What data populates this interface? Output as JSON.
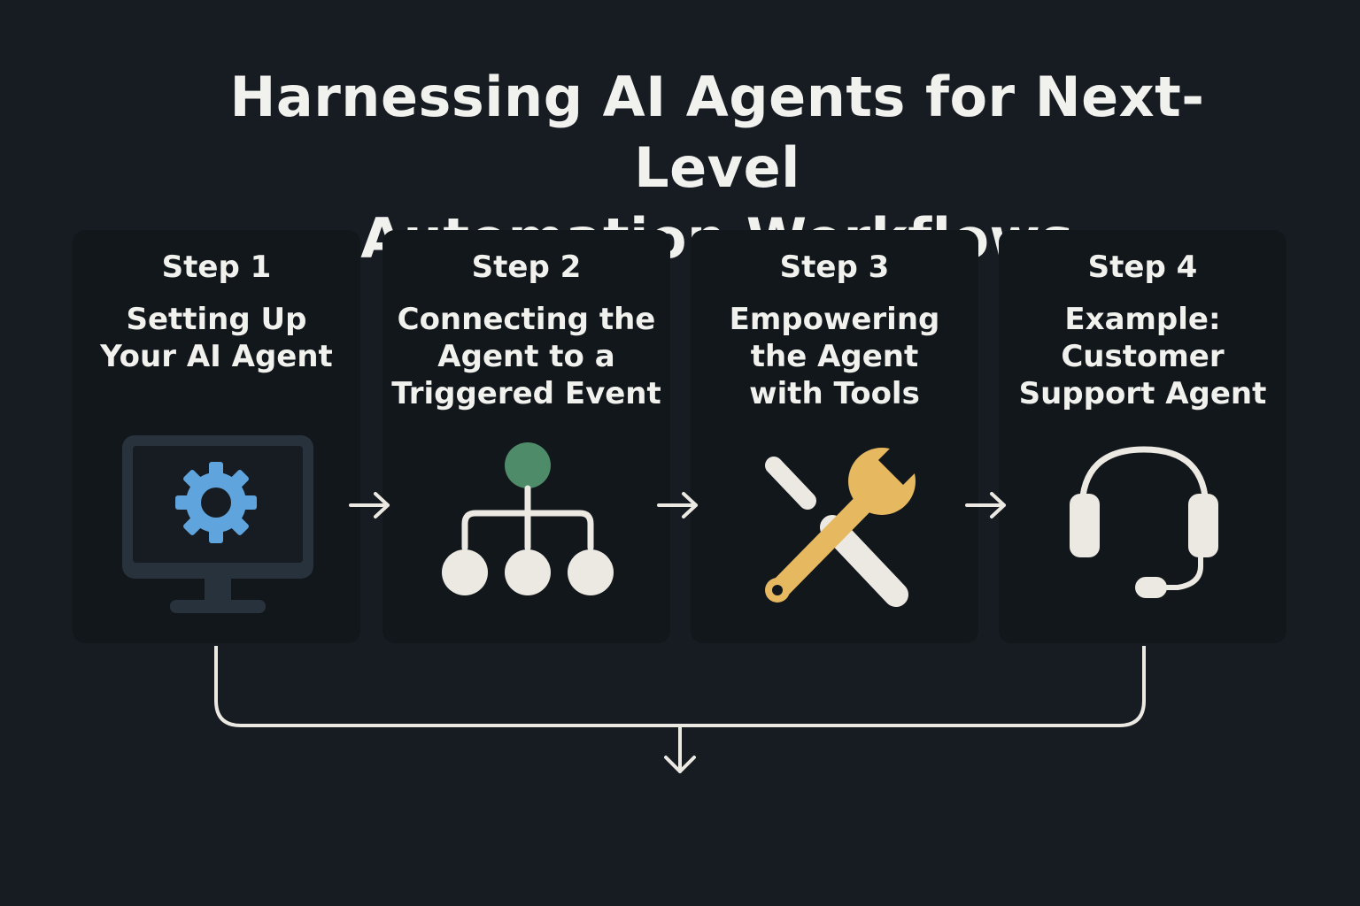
{
  "title": {
    "line1": "Harnessing AI Agents for Next-Level",
    "line2": "Automation Workflows"
  },
  "steps": [
    {
      "label": "Step 1",
      "desc": [
        "Setting Up",
        "Your AI Agent"
      ],
      "icon": "monitor-gear-icon"
    },
    {
      "label": "Step 2",
      "desc": [
        "Connecting the",
        "Agent to a",
        "Triggered Event"
      ],
      "icon": "hierarchy-icon"
    },
    {
      "label": "Step 3",
      "desc": [
        "Empowering",
        "the Agent",
        "with Tools"
      ],
      "icon": "tools-icon"
    },
    {
      "label": "Step 4",
      "desc": [
        "Example:",
        "Customer",
        "Support Agent"
      ],
      "icon": "headset-icon"
    }
  ],
  "colors": {
    "background": "#161c22",
    "card": "#12171c",
    "text": "#f1f1ee",
    "gear_blue": "#5fa4dc",
    "monitor": "#28323c",
    "node_green": "#4d8b69",
    "wrench_yellow": "#e6b85f",
    "light": "#ece9e2"
  }
}
